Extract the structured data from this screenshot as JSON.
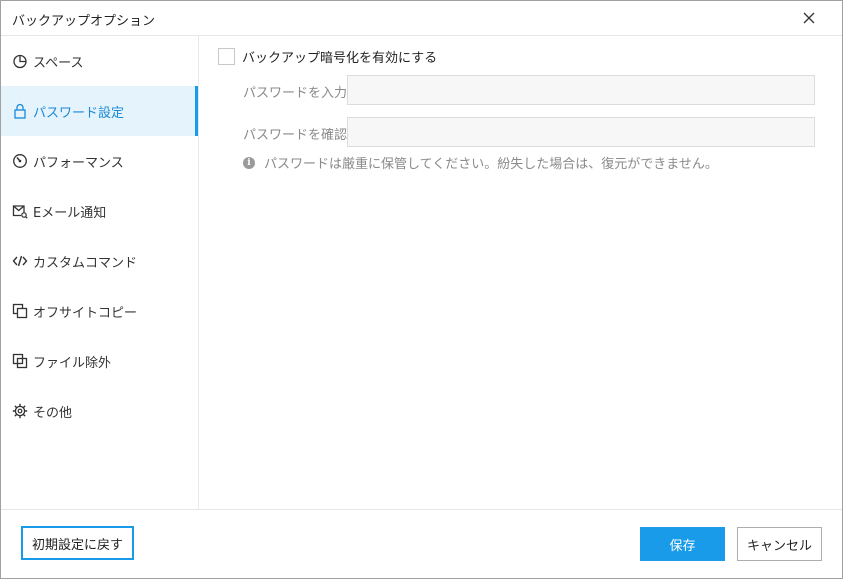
{
  "window": {
    "title": "バックアップオプション"
  },
  "sidebar": {
    "items": [
      {
        "label": "スペース",
        "icon": "pie-chart-icon",
        "active": false
      },
      {
        "label": "パスワード設定",
        "icon": "lock-icon",
        "active": true
      },
      {
        "label": "パフォーマンス",
        "icon": "gauge-icon",
        "active": false
      },
      {
        "label": "Eメール通知",
        "icon": "mail-search-icon",
        "active": false
      },
      {
        "label": "カスタムコマンド",
        "icon": "code-icon",
        "active": false
      },
      {
        "label": "オフサイトコピー",
        "icon": "copy-icon",
        "active": false
      },
      {
        "label": "ファイル除外",
        "icon": "exclude-icon",
        "active": false
      },
      {
        "label": "その他",
        "icon": "gear-icon",
        "active": false
      }
    ]
  },
  "main": {
    "encryption_label": "バックアップ暗号化を有効にする",
    "encryption_checked": false,
    "password_label": "パスワードを入力",
    "password_value": "",
    "confirm_label": "パスワードを確認",
    "confirm_value": "",
    "info_text": "パスワードは厳重に保管してください。紛失した場合は、復元ができません。"
  },
  "footer": {
    "reset_label": "初期設定に戻す",
    "save_label": "保存",
    "cancel_label": "キャンセル"
  },
  "colors": {
    "accent": "#1a9bea",
    "active_bg": "#e5f3fc"
  }
}
